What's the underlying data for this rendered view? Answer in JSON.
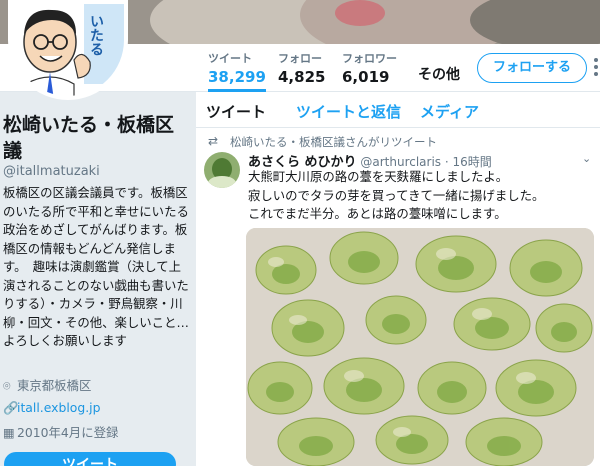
{
  "banner": {
    "alt": ""
  },
  "nav": {
    "stats": [
      {
        "label": "ツイート",
        "value": "38,299"
      },
      {
        "label": "フォロー",
        "value": "4,825"
      },
      {
        "label": "フォロワー",
        "value": "6,019"
      }
    ],
    "more": "その他",
    "follow_button": "フォローする"
  },
  "avatar_text": "いたる",
  "profile": {
    "name": "松崎いたる・板橋区議",
    "handle": "@itallmatuzaki",
    "bio": "板橋区の区議会議員です。板橋区のいたる所で平和と幸せにいたる政治をめざしてがんばります。板橋区の情報もどんどん発信します。　趣味は演劇鑑賞（決して上演されることのない戯曲も書いたりする）・カメラ・野鳥観察・川柳・回文・その他、楽しいこと…　よろしくお願いします",
    "location": "東京都板橋区",
    "url": "itall.exblog.jp",
    "joined": "2010年4月に登録",
    "tweet_button": "ツイート"
  },
  "timeline": {
    "tabs": [
      "ツイート",
      "ツイートと返信",
      "メディア"
    ],
    "retweet_by": "松崎いたる・板橋区議さんがリツイート",
    "tweet": {
      "author_name": "あさくら めひかり",
      "author_handle": "@arthurclaris",
      "time": "· 16時間",
      "text_lines": [
        "大熊町大川原の路の薹を天麩羅にしましたよ。",
        "寂しいのでタラの芽を買ってきて一緒に揚げました。",
        "これでまだ半分。あとは路の薹味噌にします。"
      ]
    }
  },
  "icons": {
    "retweet": "retweet-icon",
    "location": "location-icon",
    "link": "link-icon",
    "calendar": "calendar-icon",
    "caret": "chevron-down-icon",
    "kebab": "more-vertical-icon"
  },
  "colors": {
    "accent": "#1da1f2",
    "secondary_text": "#657786",
    "background": "#e6ecf0"
  }
}
